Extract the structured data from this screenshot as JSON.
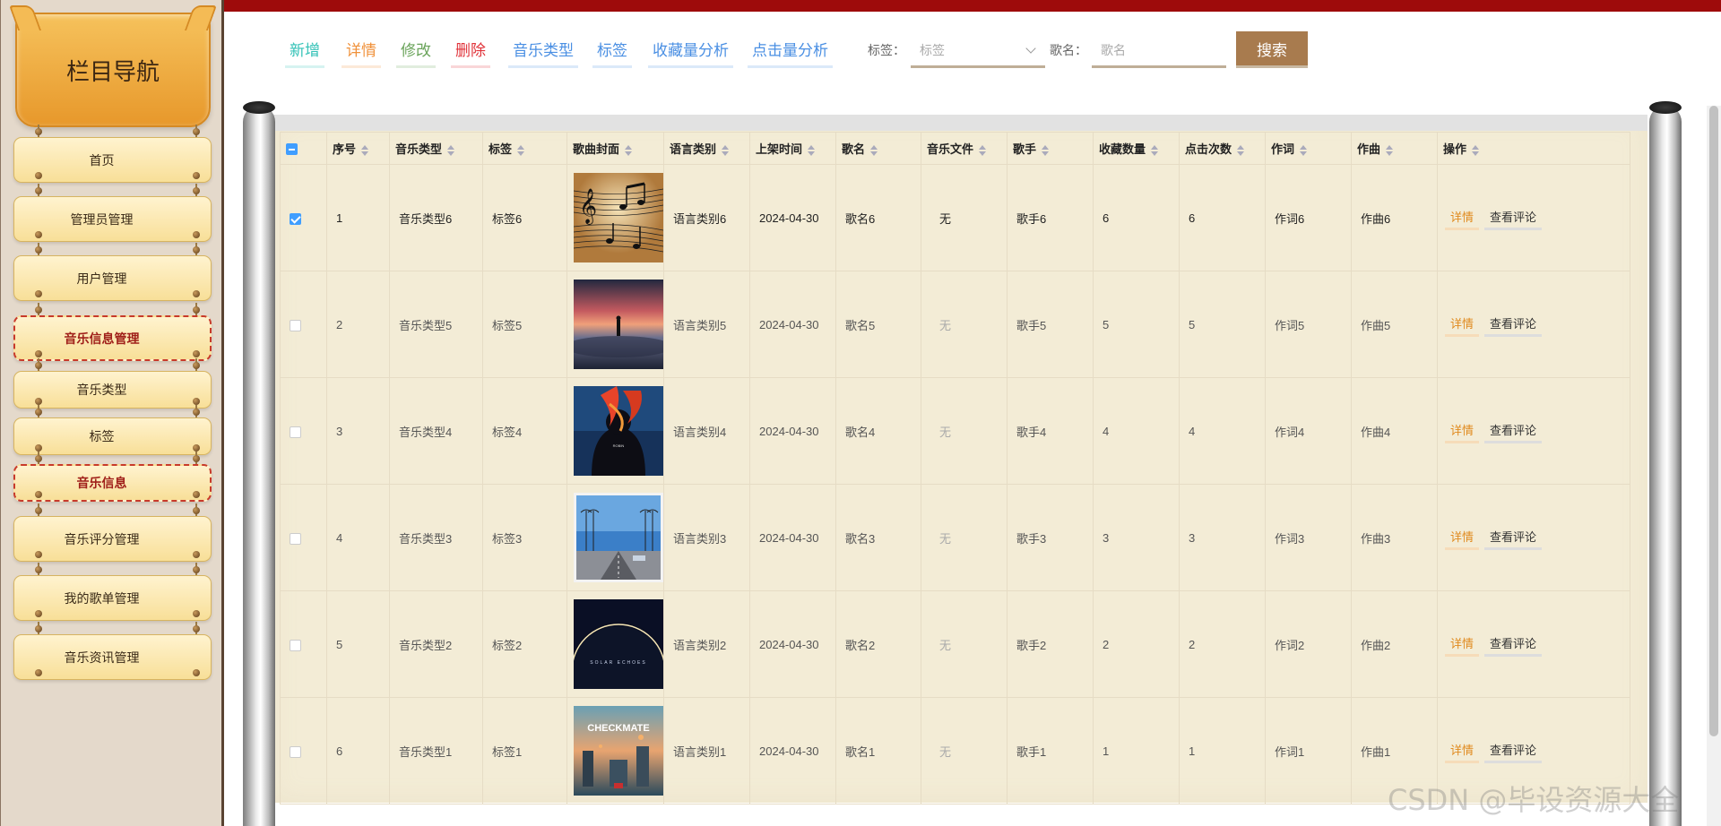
{
  "sidebar": {
    "title": "栏目导航",
    "items": [
      {
        "label": "首页",
        "active": false
      },
      {
        "label": "管理员管理",
        "active": false
      },
      {
        "label": "用户管理",
        "active": false
      },
      {
        "label": "音乐信息管理",
        "active": true
      },
      {
        "label": "音乐类型",
        "active": false
      },
      {
        "label": "标签",
        "active": false
      },
      {
        "label": "音乐信息",
        "active": true
      },
      {
        "label": "音乐评分管理",
        "active": false
      },
      {
        "label": "我的歌单管理",
        "active": false
      },
      {
        "label": "音乐资讯管理",
        "active": false
      }
    ]
  },
  "toolbar": {
    "buttons": [
      {
        "label": "新增",
        "color": "#33c2b7"
      },
      {
        "label": "详情",
        "color": "#f0913a"
      },
      {
        "label": "修改",
        "color": "#6aa45b"
      },
      {
        "label": "删除",
        "color": "#e0333a"
      },
      {
        "label": "音乐类型",
        "color": "#4a8fe3"
      },
      {
        "label": "标签",
        "color": "#4a8fe3"
      },
      {
        "label": "收藏量分析",
        "color": "#4a8fe3"
      },
      {
        "label": "点击量分析",
        "color": "#4a8fe3"
      }
    ],
    "tag_label": "标签：",
    "tag_placeholder": "标签",
    "name_label": "歌名：",
    "name_placeholder": "歌名",
    "search_label": "搜索"
  },
  "table": {
    "headers": [
      "序号",
      "音乐类型",
      "标签",
      "歌曲封面",
      "语言类别",
      "上架时间",
      "歌名",
      "音乐文件",
      "歌手",
      "收藏数量",
      "点击次数",
      "作词",
      "作曲",
      "操作"
    ],
    "rows": [
      {
        "selected": true,
        "no": "1",
        "type": "音乐类型6",
        "tag": "标签6",
        "cover": "sheet-music",
        "lang": "语言类别6",
        "date": "2024-04-30",
        "name": "歌名6",
        "file": "无",
        "singer": "歌手6",
        "fav": "6",
        "clicks": "6",
        "lyricist": "作词6",
        "composer": "作曲6"
      },
      {
        "selected": false,
        "no": "2",
        "type": "音乐类型5",
        "tag": "标签5",
        "cover": "sunset-figure",
        "lang": "语言类别5",
        "date": "2024-04-30",
        "name": "歌名5",
        "file": "无",
        "singer": "歌手5",
        "fav": "5",
        "clicks": "5",
        "lyricist": "作词5",
        "composer": "作曲5"
      },
      {
        "selected": false,
        "no": "3",
        "type": "音乐类型4",
        "tag": "标签4",
        "cover": "flower-silhouette",
        "lang": "语言类别4",
        "date": "2024-04-30",
        "name": "歌名4",
        "file": "无",
        "singer": "歌手4",
        "fav": "4",
        "clicks": "4",
        "lyricist": "作词4",
        "composer": "作曲4"
      },
      {
        "selected": false,
        "no": "4",
        "type": "音乐类型3",
        "tag": "标签3",
        "cover": "palm-road",
        "lang": "语言类别3",
        "date": "2024-04-30",
        "name": "歌名3",
        "file": "无",
        "singer": "歌手3",
        "fav": "3",
        "clicks": "3",
        "lyricist": "作词3",
        "composer": "作曲3"
      },
      {
        "selected": false,
        "no": "5",
        "type": "音乐类型2",
        "tag": "标签2",
        "cover": "eclipse",
        "lang": "语言类别2",
        "date": "2024-04-30",
        "name": "歌名2",
        "file": "无",
        "singer": "歌手2",
        "fav": "2",
        "clicks": "2",
        "lyricist": "作词2",
        "composer": "作曲2"
      },
      {
        "selected": false,
        "no": "6",
        "type": "音乐类型1",
        "tag": "标签1",
        "cover": "checkmate-city",
        "lang": "语言类别1",
        "date": "2024-04-30",
        "name": "歌名1",
        "file": "无",
        "singer": "歌手1",
        "fav": "1",
        "clicks": "1",
        "lyricist": "作词1",
        "composer": "作曲1"
      }
    ],
    "ops": {
      "detail": "详情",
      "comments": "查看评论"
    }
  },
  "cover_texts": {
    "eclipse": "SOLAR ECHOES",
    "checkmate": "CHECKMATE"
  },
  "watermark": "CSDN @毕设资源大全"
}
